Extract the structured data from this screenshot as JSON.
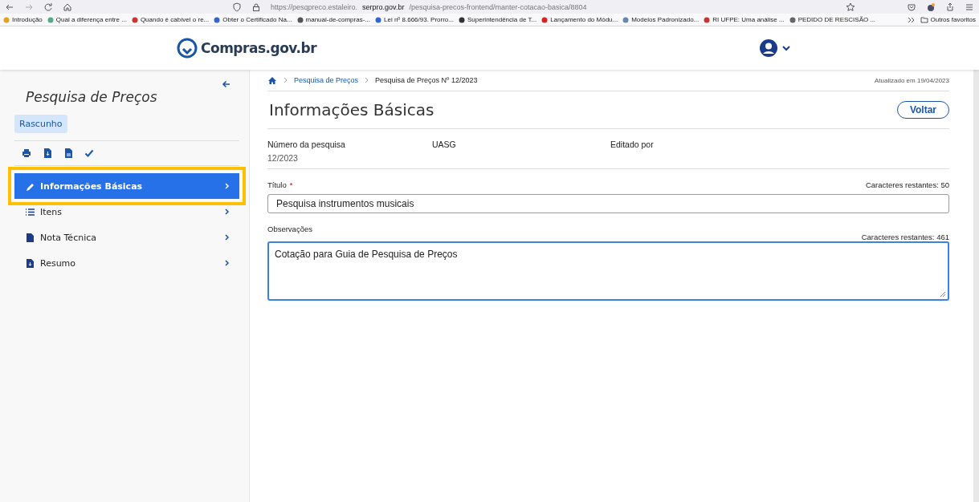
{
  "browser": {
    "url": "https://pesqpreco.estaleiro.**serpro.gov.br**/pesquisa-precos-frontend/manter-cotacao-basica/8804",
    "bookmarks": [
      {
        "label": "Introdução"
      },
      {
        "label": "Qual a diferença entre ..."
      },
      {
        "label": "Quando é cabível o re..."
      },
      {
        "label": "Obter o Certificado Na..."
      },
      {
        "label": "manual-de-compras-..."
      },
      {
        "label": "Lei nº 8.666/93. Prorro..."
      },
      {
        "label": "Superintendência de T..."
      },
      {
        "label": "Lançamento do Módu..."
      },
      {
        "label": "Modelos Padronizado..."
      },
      {
        "label": "RI UFPE: Uma análise ..."
      },
      {
        "label": "PEDIDO DE RESCISÃO ..."
      }
    ],
    "other_bookmarks": "Outros favoritos"
  },
  "header": {
    "logo_text": "Compras.gov.br"
  },
  "sidebar": {
    "title": "Pesquisa de Preços",
    "status": "Rascunho",
    "items": [
      {
        "label": "Informações Básicas",
        "kind": "pencil",
        "selected": true
      },
      {
        "label": "Itens",
        "kind": "list",
        "selected": false
      },
      {
        "label": "Nota Técnica",
        "kind": "file",
        "selected": false
      },
      {
        "label": "Resumo",
        "kind": "file-download",
        "selected": false
      }
    ]
  },
  "breadcrumb": [
    "Pesquisa de Preços",
    "Pesquisa de Preços Nº 12/2023"
  ],
  "updated": "Atualizado em 19/04/2023",
  "page_title": "Informações Básicas",
  "back_button": "Voltar",
  "info": [
    {
      "label": "Número da pesquisa",
      "value": "12/2023"
    },
    {
      "label": "UASG"
    },
    {
      "label": "Editado por"
    }
  ],
  "form": [
    {
      "label": "Título",
      "required_mark": "*",
      "counter": "Caracteres restantes: 50",
      "value": "Pesquisa instrumentos musicais",
      "kind": "input",
      "focused": false
    },
    {
      "label": "Observações",
      "counter": "Caracteres restantes: 461",
      "value": "Cotação para Guia de Pesquisa de Preços",
      "kind": "textarea",
      "focused": true
    }
  ]
}
